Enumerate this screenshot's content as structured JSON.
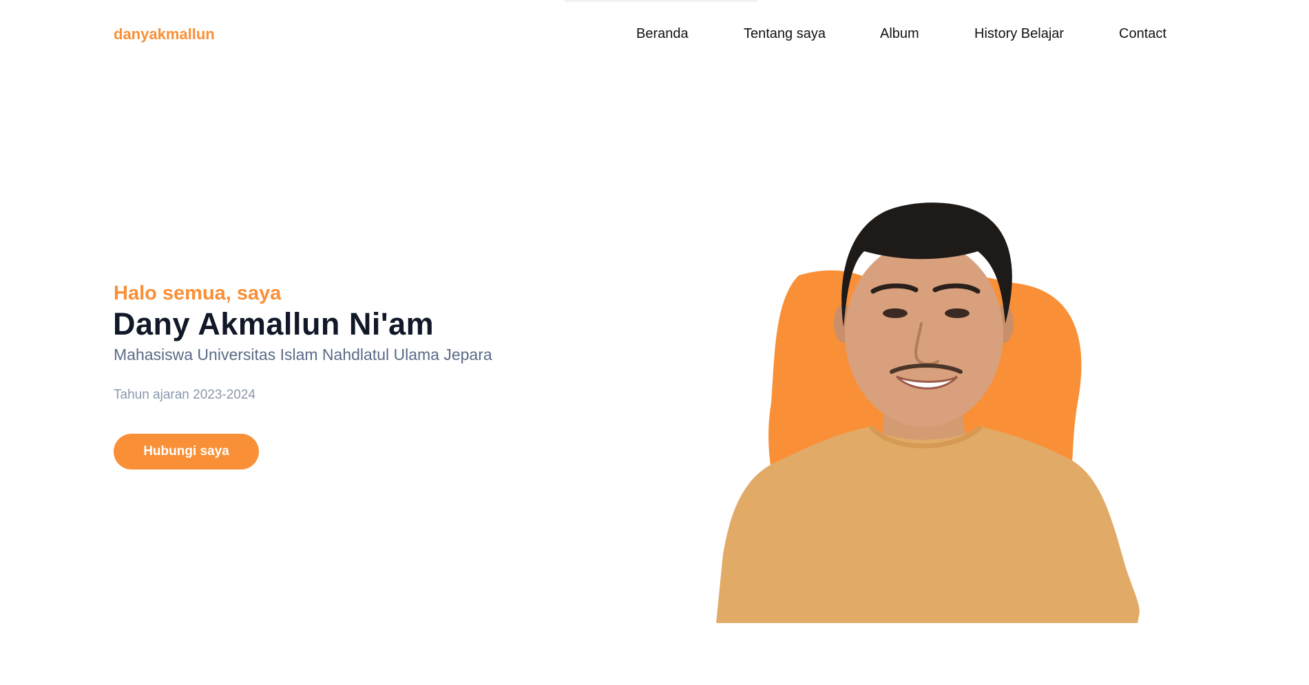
{
  "brand": {
    "name": "danyakmallun",
    "accent_color": "#f98f36"
  },
  "nav": {
    "items": [
      {
        "label": "Beranda"
      },
      {
        "label": "Tentang saya"
      },
      {
        "label": "Album"
      },
      {
        "label": "History Belajar"
      },
      {
        "label": "Contact"
      }
    ]
  },
  "hero": {
    "greeting": "Halo semua, saya",
    "name": "Dany Akmallun Ni'am",
    "subtitle": "Mahasiswa Universitas Islam Nahdlatul Ulama Jepara",
    "year": "Tahun ajaran 2023-2024",
    "cta_label": "Hubungi saya"
  },
  "portrait": {
    "icon": "portrait-photo",
    "blob_color": "#f98f36",
    "shirt_color": "#e7a964"
  }
}
